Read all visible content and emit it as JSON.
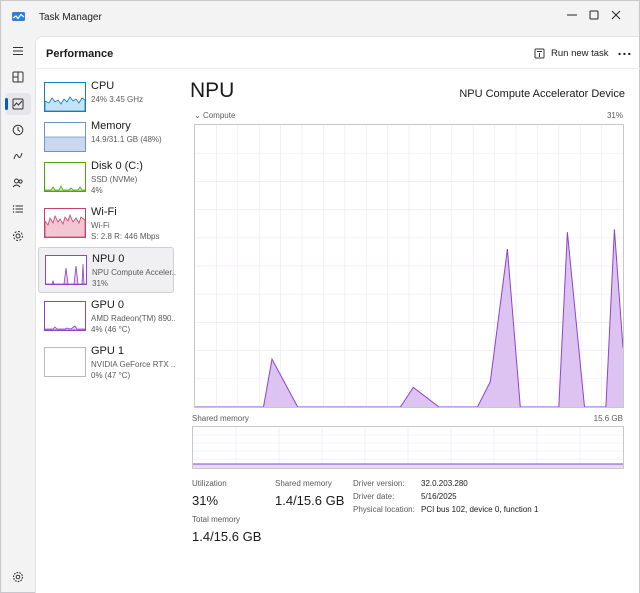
{
  "window": {
    "title": "Task Manager",
    "accent": "#005fb8"
  },
  "header": {
    "title": "Performance",
    "run_task_label": "Run new task",
    "more_label": "..."
  },
  "nav_icons": [
    "hamburger-icon",
    "processes-icon",
    "performance-icon",
    "app-history-icon",
    "startup-apps-icon",
    "users-icon",
    "details-icon",
    "services-icon",
    "settings-icon"
  ],
  "devices": [
    {
      "name": "CPU",
      "line1": "24%  3.45 GHz",
      "line2": "",
      "line3": "",
      "color": "#117dbb"
    },
    {
      "name": "Memory",
      "line1": "14.9/31.1 GB (48%)",
      "line2": "",
      "line3": "",
      "color": "#6e94c7"
    },
    {
      "name": "Disk 0 (C:)",
      "line1": "SSD (NVMe)",
      "line2": "4%",
      "line3": "",
      "color": "#4da60c"
    },
    {
      "name": "Wi-Fi",
      "line1": "Wi-Fi",
      "line2": "S: 2.8  R: 446 Mbps",
      "line3": "",
      "color": "#c7426a"
    },
    {
      "name": "NPU 0",
      "line1": "NPU Compute Acceler...",
      "line2": "31%",
      "line3": "",
      "color": "#8e44c7"
    },
    {
      "name": "GPU 0",
      "line1": "AMD Radeon(TM) 890...",
      "line2": "4%  (46 °C)",
      "line3": "",
      "color": "#8e44c7"
    },
    {
      "name": "GPU 1",
      "line1": "NVIDIA GeForce RTX ...",
      "line2": "0%  (47 °C)",
      "line3": "",
      "color": "#8e44c7"
    }
  ],
  "detail": {
    "title": "NPU",
    "device": "NPU Compute Accelerator Device",
    "graph_label": "Compute",
    "graph_percent": "31%",
    "shared_memory_label": "Shared memory",
    "shared_memory_max": "15.6 GB",
    "utilization_label": "Utilization",
    "utilization_value": "31%",
    "shared_label": "Shared memory",
    "shared_value": "1.4/15.6 GB",
    "total_label": "Total memory",
    "total_value": "1.4/15.6 GB",
    "driver_version_label": "Driver version:",
    "driver_version": "32.0.203.280",
    "driver_date_label": "Driver date:",
    "driver_date": "5/16/2025",
    "physical_location_label": "Physical location:",
    "physical_location": "PCI bus 102, device 0, function 1"
  },
  "chart_data": {
    "type": "area",
    "title": "Compute",
    "ylim": [
      0,
      100
    ],
    "x": [
      0,
      16,
      18,
      24,
      48,
      51,
      57,
      66,
      69,
      73,
      76,
      85,
      87,
      91,
      96,
      98,
      100
    ],
    "series": [
      {
        "values": [
          0,
          0,
          17,
          0,
          0,
          7,
          0,
          0,
          9,
          56,
          0,
          0,
          62,
          0,
          0,
          63,
          21
        ]
      }
    ]
  }
}
